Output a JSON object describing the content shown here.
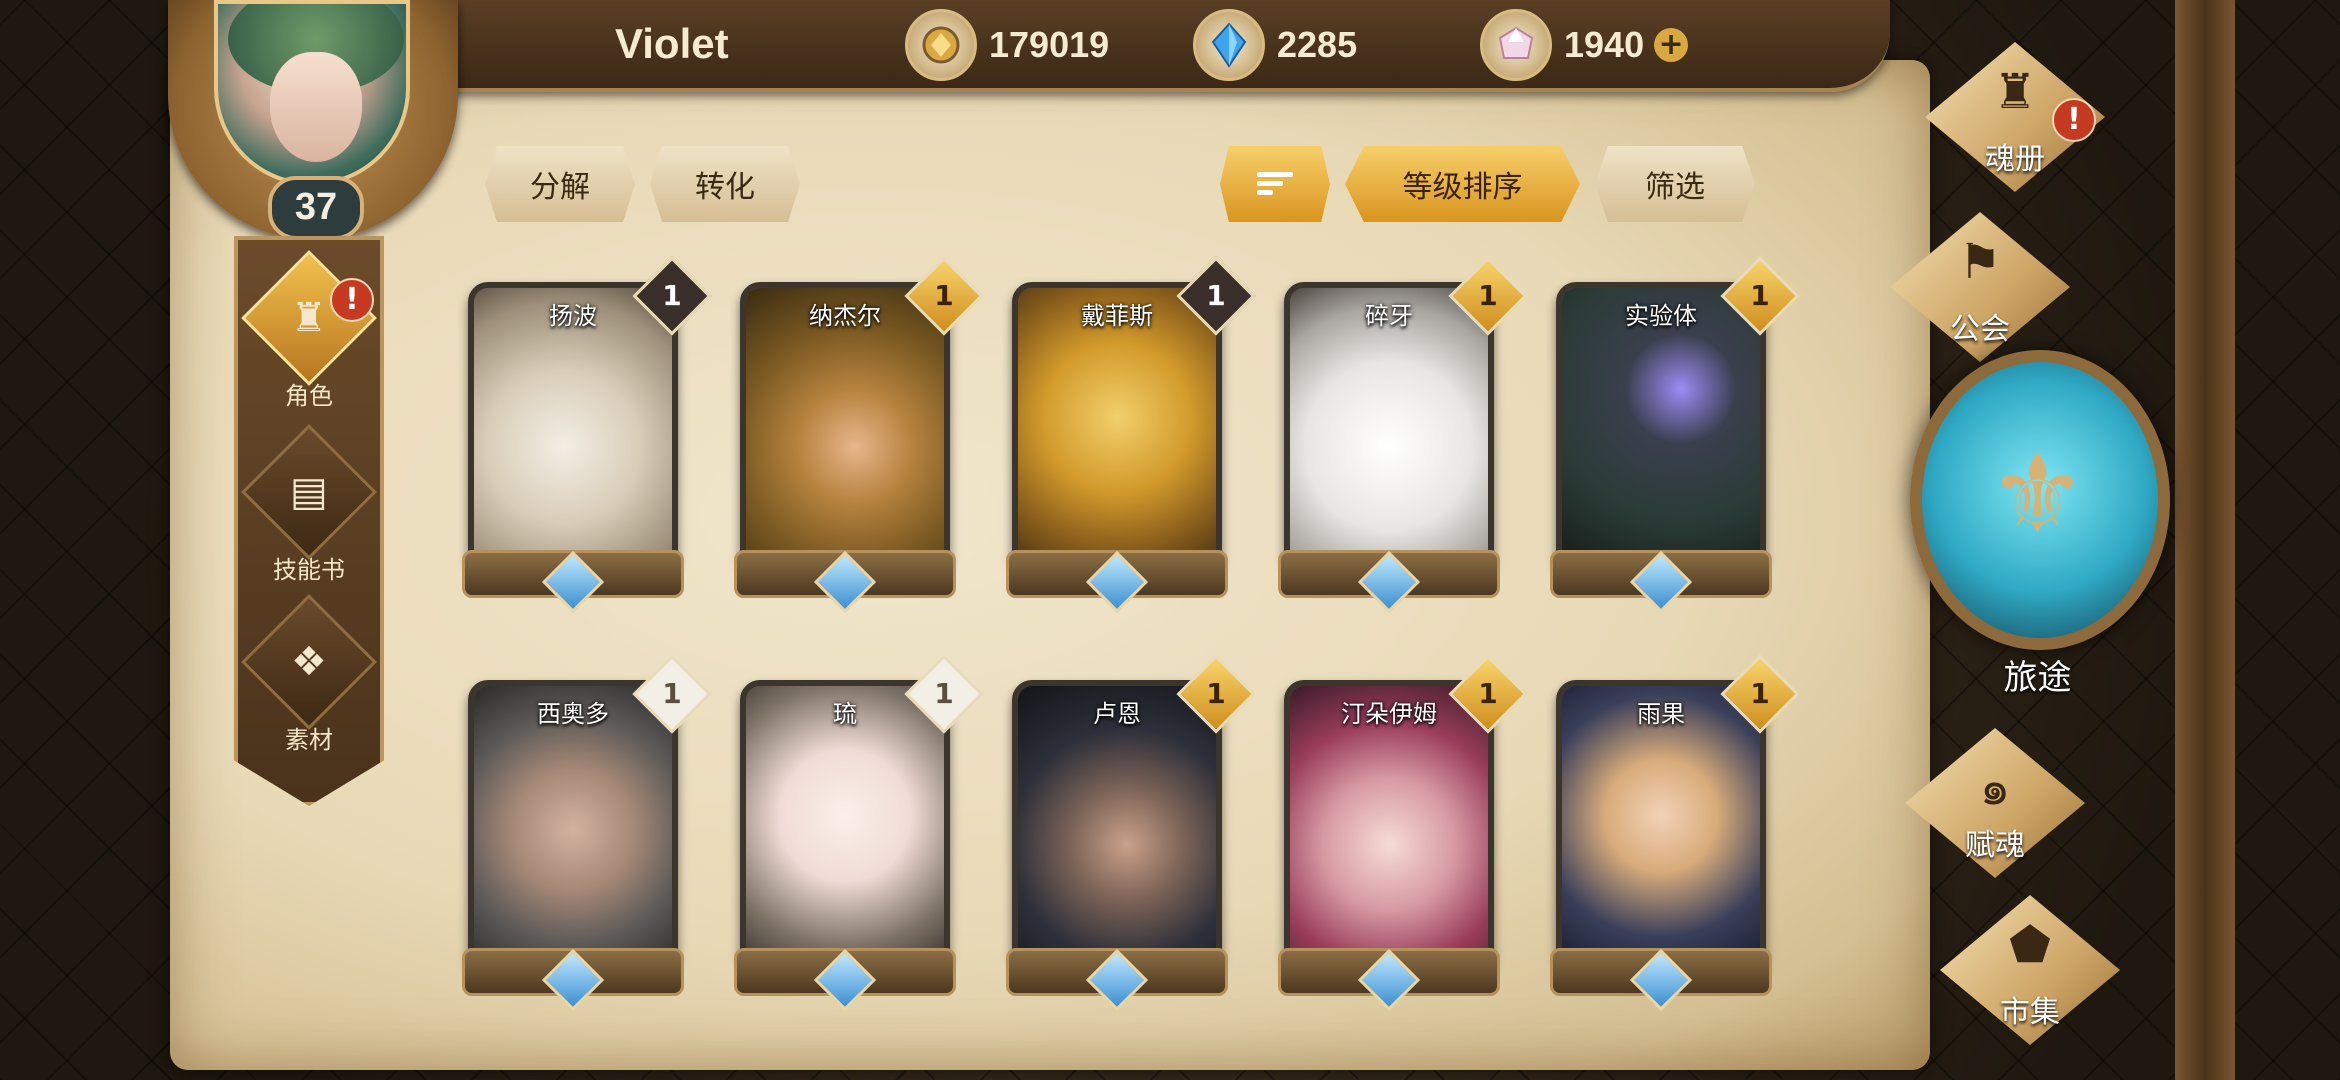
{
  "header": {
    "player_name": "Violet",
    "level": "37",
    "resources": [
      {
        "icon": "gold-coin-icon",
        "value": "179019"
      },
      {
        "icon": "blue-crystal-icon",
        "value": "2285"
      },
      {
        "icon": "pink-gem-icon",
        "value": "1940"
      }
    ],
    "add_symbol": "+"
  },
  "sidebar": {
    "items": [
      {
        "label": "角色",
        "icon": "helmet-icon",
        "active": true,
        "alert": "!"
      },
      {
        "label": "技能书",
        "icon": "book-icon",
        "active": false
      },
      {
        "label": "素材",
        "icon": "material-icon",
        "active": false
      }
    ]
  },
  "toolbar": {
    "decompose": "分解",
    "convert": "转化",
    "sort_by_level": "等级排序",
    "filter": "筛选"
  },
  "cards": [
    {
      "name": "扬波",
      "badge": "1",
      "badge_style": "dark"
    },
    {
      "name": "纳杰尔",
      "badge": "1",
      "badge_style": "gold"
    },
    {
      "name": "戴菲斯",
      "badge": "1",
      "badge_style": "dark"
    },
    {
      "name": "碎牙",
      "badge": "1",
      "badge_style": "gold"
    },
    {
      "name": "实验体",
      "badge": "1",
      "badge_style": "gold"
    },
    {
      "name": "西奥多",
      "badge": "1",
      "badge_style": "white"
    },
    {
      "name": "琉",
      "badge": "1",
      "badge_style": "white"
    },
    {
      "name": "卢恩",
      "badge": "1",
      "badge_style": "gold"
    },
    {
      "name": "汀朵伊姆",
      "badge": "1",
      "badge_style": "gold"
    },
    {
      "name": "雨果",
      "badge": "1",
      "badge_style": "gold"
    }
  ],
  "right_menu": {
    "soul_book": "魂册",
    "soul_book_alert": "!",
    "guild": "公会",
    "journey": "旅途",
    "endow_soul": "赋魂",
    "market": "市集"
  },
  "colors": {
    "accent_gold": "#f2c14d",
    "alert_red": "#c73a22",
    "parchment": "#e8d9b6"
  }
}
